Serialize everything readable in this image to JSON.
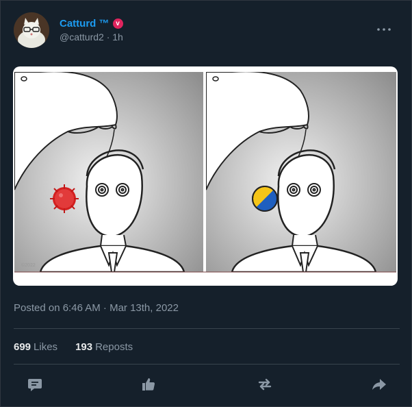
{
  "author": {
    "display_name": "Catturd ™",
    "verified_badge": "v",
    "handle": "@catturd2",
    "separator": "·",
    "relative_time": "1h"
  },
  "menu_icon": "more-horizontal-icon",
  "media": {
    "left_panel_badge": "virus",
    "right_panel_badge": "ukraine-flag"
  },
  "timestamp": "Posted on 6:46 AM · Mar 13th, 2022",
  "stats": {
    "likes_count": "699",
    "likes_label": "Likes",
    "reposts_count": "193",
    "reposts_label": "Reposts"
  },
  "actions": [
    "reply-icon",
    "like-icon",
    "repost-icon",
    "share-icon"
  ],
  "colors": {
    "background": "#15202b",
    "accent": "#1d9bf0",
    "muted": "#8b98a5",
    "verified": "#e0245e"
  }
}
